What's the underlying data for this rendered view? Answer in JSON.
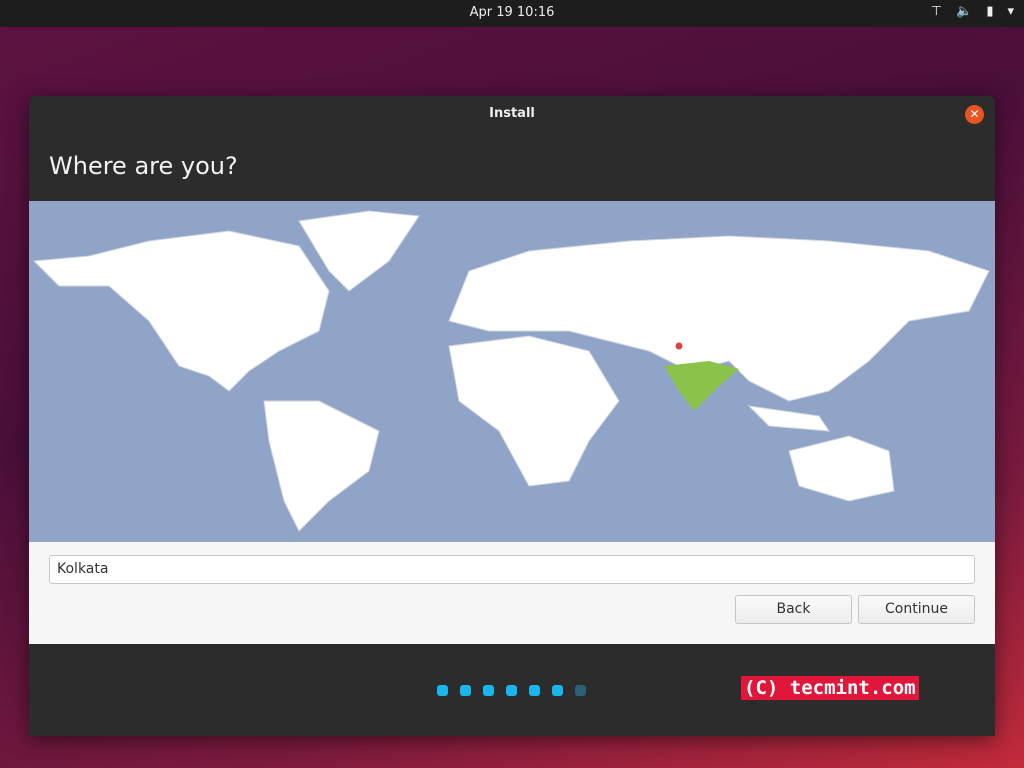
{
  "topbar": {
    "clock": "Apr 19  10:16",
    "icons": [
      "network-icon",
      "volume-icon",
      "battery-icon",
      "menu-down-icon"
    ]
  },
  "window": {
    "title": "Install",
    "heading": "Where are you?"
  },
  "location": {
    "value": "Kolkata",
    "selected_country": "India"
  },
  "buttons": {
    "back": "Back",
    "continue": "Continue"
  },
  "progress": {
    "total": 7,
    "completed": 6
  },
  "watermark": "(C) tecmint.com",
  "colors": {
    "accent": "#e95420",
    "progress": "#19b6ee",
    "highlight": "#8bc34a",
    "ocean": "#8fa4c6"
  }
}
